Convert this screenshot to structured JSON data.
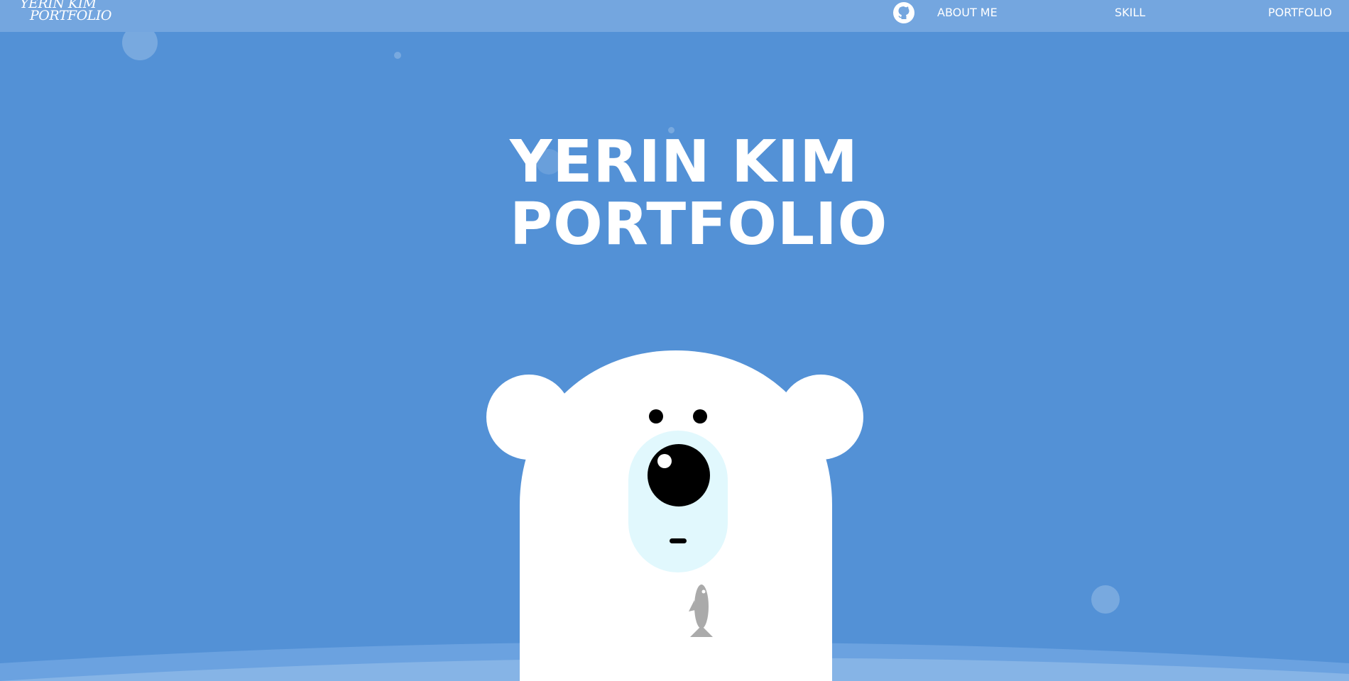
{
  "header": {
    "logo": {
      "line1": "YERIN KIM",
      "line2": "PORTFOLIO"
    },
    "github_icon": "github-icon",
    "nav": [
      {
        "label": "ABOUT ME"
      },
      {
        "label": "SKILL"
      },
      {
        "label": "PORTFOLIO"
      }
    ]
  },
  "hero": {
    "title_line1": "YERIN KIM",
    "title_line2": "PORTFOLIO",
    "illustration": "polar-bear-holding-fish"
  },
  "colors": {
    "background": "#5391d6",
    "navbar": "#74a6df",
    "bear": "#ffffff",
    "muzzle": "#e1f8fd",
    "fish": "#aaaaaa"
  }
}
